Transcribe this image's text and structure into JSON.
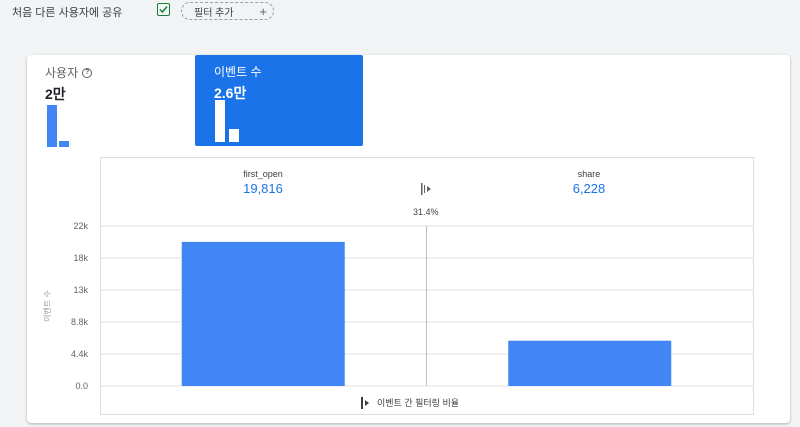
{
  "toolbar": {
    "compare_dropdown": "처음 다른 사용자에 공유",
    "filter_chip": "필터 추가",
    "filter_add": "+"
  },
  "metrics": {
    "users": {
      "label": "사용자",
      "help": "?",
      "value": "2만"
    },
    "events": {
      "label": "이벤트 수",
      "value": "2.6만"
    }
  },
  "funnel": {
    "step1": {
      "name": "first_open",
      "count": "19,816"
    },
    "step2": {
      "name": "share",
      "count": "6,228"
    },
    "conversion": "31.4%"
  },
  "chart_data": {
    "type": "bar",
    "categories": [
      "first_open",
      "share"
    ],
    "values": [
      19816,
      6228
    ],
    "ylabel": "이벤트 수",
    "yticks": [
      "0.0",
      "4.4k",
      "8.8k",
      "13k",
      "18k",
      "22k"
    ],
    "ylim": [
      0,
      22000
    ],
    "grid": true,
    "color": "#4285f4"
  },
  "legend": {
    "label": "이벤트 간 필터링 비율"
  },
  "colors": {
    "accent": "#1a73e8",
    "bar": "#4285f4",
    "check": "#188038"
  }
}
